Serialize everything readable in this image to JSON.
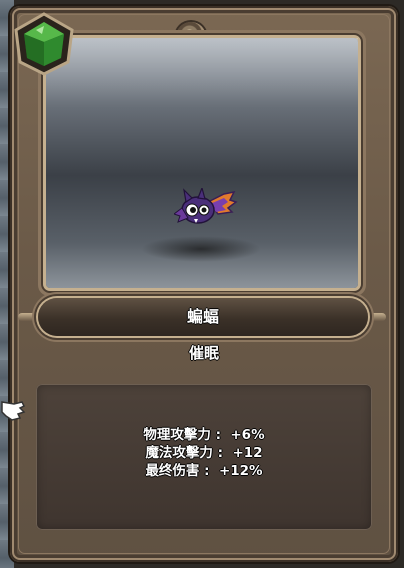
{
  "monster": {
    "name": "蝙蝠",
    "skill": "催眠"
  },
  "stats": [
    {
      "label": "物理攻擊力",
      "value": "+6%"
    },
    {
      "label": "魔法攻擊力",
      "value": "+12"
    },
    {
      "label": "最终伤害",
      "value": "+12%"
    }
  ],
  "icons": {
    "rank_gem": "green-gem-icon",
    "cursor": "hand-pointer-icon"
  },
  "colors": {
    "gem": "#2f8a2e",
    "frame": "#7b6853",
    "bat_body": "#4a2f7a",
    "bat_wing": "#e07a2d"
  }
}
